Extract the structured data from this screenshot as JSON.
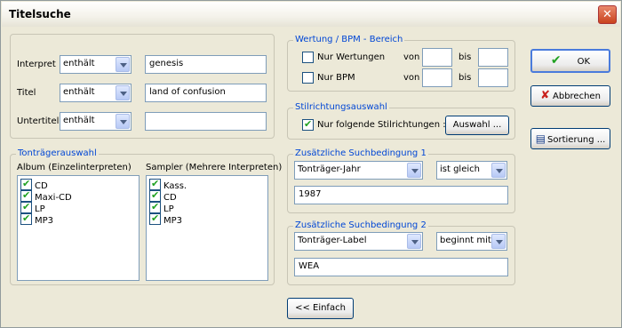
{
  "window": {
    "title": "Titelsuche"
  },
  "search": {
    "rows": [
      {
        "label": "Interpret",
        "mode": "enthält",
        "value": "genesis"
      },
      {
        "label": "Titel",
        "mode": "enthält",
        "value": "land of confusion"
      },
      {
        "label": "Untertitel",
        "mode": "enthält",
        "value": ""
      }
    ]
  },
  "rating": {
    "legend": "Wertung / BPM - Bereich",
    "only_ratings": {
      "label": "Nur Wertungen",
      "checked": false,
      "from_label": "von",
      "to_label": "bis",
      "from": "",
      "to": ""
    },
    "only_bpm": {
      "label": "Nur BPM",
      "checked": false,
      "from_label": "von",
      "to_label": "bis",
      "from": "",
      "to": ""
    }
  },
  "style": {
    "legend": "Stilrichtungsauswahl",
    "only_following": {
      "label": "Nur folgende Stilrichtungen :",
      "checked": true
    },
    "select_button": "Auswahl ..."
  },
  "medium": {
    "legend": "Tonträgerauswahl",
    "album": {
      "header": "Album (Einzelinterpreten)",
      "items": [
        "CD",
        "Maxi-CD",
        "LP",
        "MP3"
      ]
    },
    "sampler": {
      "header": "Sampler (Mehrere Interpreten)",
      "items": [
        "Kass.",
        "CD",
        "LP",
        "MP3"
      ]
    }
  },
  "cond1": {
    "legend": "Zusätzliche Suchbedingung 1",
    "field": "Tonträger-Jahr",
    "operator": "ist gleich",
    "value": "1987"
  },
  "cond2": {
    "legend": "Zusätzliche Suchbedingung 2",
    "field": "Tonträger-Label",
    "operator": "beginnt mit",
    "value": "WEA"
  },
  "buttons": {
    "ok": "OK",
    "cancel": "Abbrechen",
    "sort": "Sortierung ...",
    "simple": "<<  Einfach"
  },
  "colors": {
    "legend": "#0046d5",
    "ok_check": "#21a121",
    "cancel_x": "#c9211e"
  }
}
